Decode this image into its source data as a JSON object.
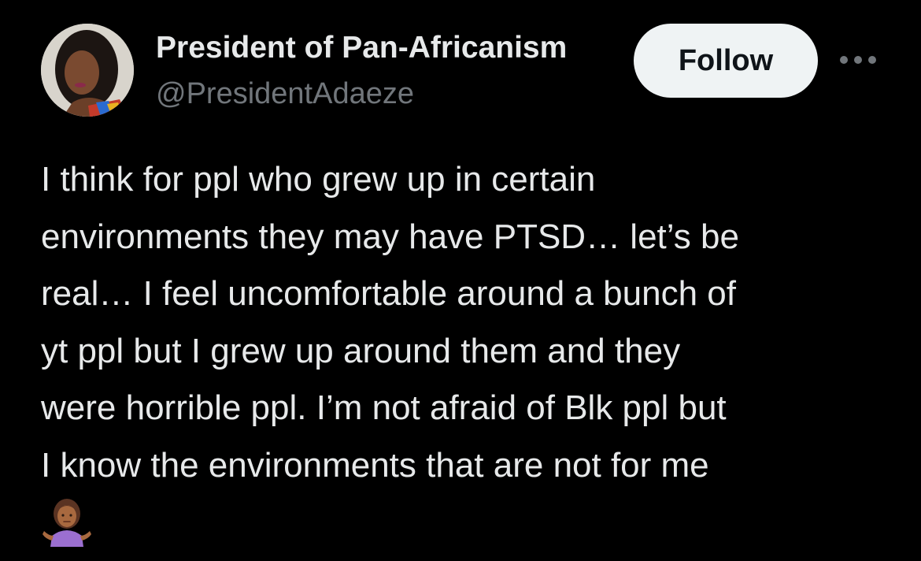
{
  "author": {
    "display_name": "President of Pan-Africanism",
    "handle": "@PresidentAdaeze"
  },
  "actions": {
    "follow_label": "Follow",
    "more_icon": "more-horizontal-icon"
  },
  "tweet": {
    "lines": [
      "I think for ppl who grew up in certain",
      "environments they may have PTSD… let’s be",
      "real… I feel uncomfortable around a bunch of",
      "yt ppl but I grew up around them and they",
      "were horrible ppl. I’m not afraid of Blk ppl but",
      "I know the environments that are not for me"
    ],
    "emoji": "person-shrugging-emoji"
  },
  "colors": {
    "background": "#000000",
    "primary_text": "#e7e9ea",
    "secondary_text": "#71767b",
    "follow_button_bg": "#eff3f4",
    "follow_button_text": "#0f1419"
  }
}
